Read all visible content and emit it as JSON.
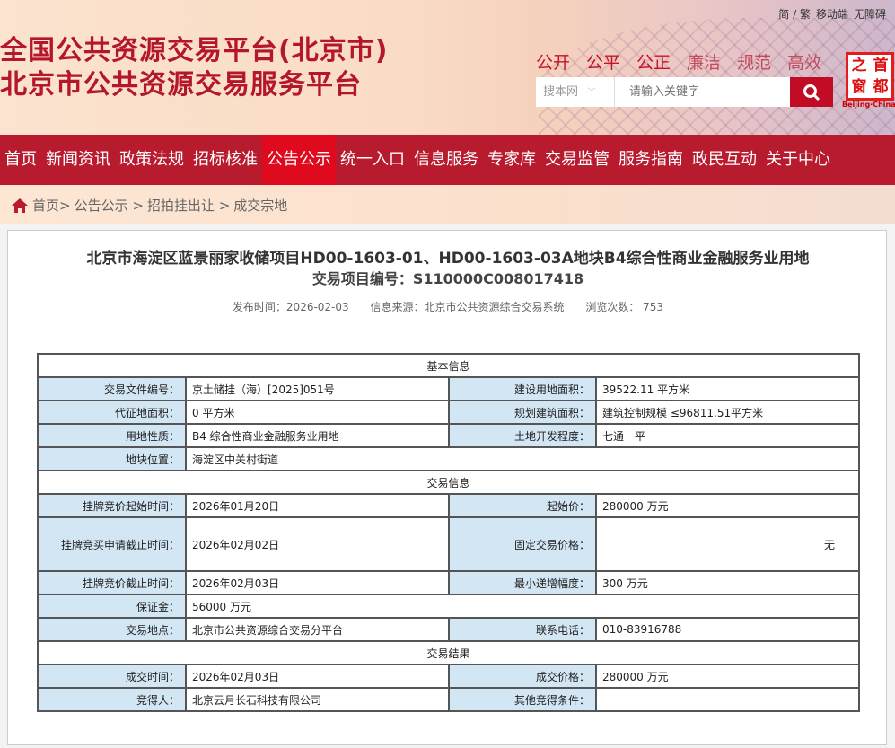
{
  "header": {
    "top_links": [
      "简 / 繁",
      "移动端",
      "无障碍"
    ],
    "title_line1": "全国公共资源交易平台(北京市)",
    "title_line2": "北京市公共资源交易服务平台",
    "slogans": [
      "公开",
      "公平",
      "公正",
      "廉洁",
      "规范",
      "高效"
    ],
    "search_scope": "搜本网",
    "search_placeholder": "请输入关键字",
    "logo_chars": [
      "之",
      "首",
      "窗",
      "都"
    ],
    "logo_sub": "Beijing·China"
  },
  "nav": [
    "首页",
    "新闻资讯",
    "政策法规",
    "招标核准",
    "公告公示",
    "统一入口",
    "信息服务",
    "专家库",
    "交易监管",
    "服务指南",
    "政民互动",
    "关于中心"
  ],
  "breadcrumb": [
    "首页>",
    "公告公示 >",
    "招拍挂出让 >",
    "成交宗地"
  ],
  "article": {
    "title": "北京市海淀区蓝景丽家收储项目HD00-1603-01、HD00-1603-03A地块B4综合性商业金融服务业用地",
    "project_no": "交易项目编号：S110000C008017418",
    "publish": "发布时间：2026-02-03",
    "source": "信息来源：北京市公共资源综合交易系统",
    "views": "浏览次数： 753"
  },
  "table": {
    "sec1": "基本信息",
    "r1": [
      "交易文件编号：",
      "京土储挂（海）[2025]051号",
      "建设用地面积：",
      "39522.11 平方米"
    ],
    "r2": [
      "代征地面积：",
      "0 平方米",
      "规划建筑面积：",
      "建筑控制规模 ≤96811.51平方米"
    ],
    "r3": [
      "用地性质：",
      "B4 综合性商业金融服务业用地",
      "土地开发程度：",
      "七通一平"
    ],
    "r4": [
      "地块位置：",
      "海淀区中关村街道"
    ],
    "sec2": "交易信息",
    "r5": [
      "挂牌竞价起始时间：",
      "2026年01月20日",
      "起始价：",
      "280000 万元"
    ],
    "r6": [
      "挂牌竞买申请截止时间：",
      "2026年02月02日",
      "固定交易价格：",
      "无"
    ],
    "r7": [
      "挂牌竞价截止时间：",
      "2026年02月03日",
      "最小递增幅度：",
      "300 万元"
    ],
    "r8": [
      "保证金：",
      "56000 万元"
    ],
    "r9": [
      "交易地点：",
      "北京市公共资源综合交易分平台",
      "联系电话：",
      "010-83916788"
    ],
    "sec3": "交易结果",
    "r10": [
      "成交时间：",
      "2026年02月03日",
      "成交价格：",
      "280000 万元"
    ],
    "r11": [
      "竞得人：",
      "北京云月长石科技有限公司",
      "其他竞得条件：",
      ""
    ]
  }
}
